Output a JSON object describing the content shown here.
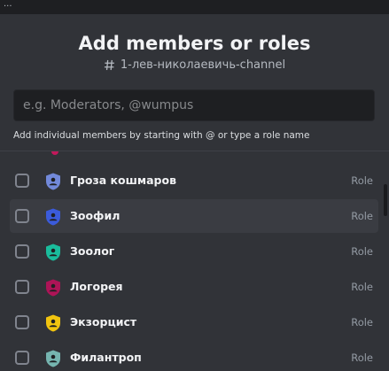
{
  "topbar": {
    "text": "..."
  },
  "modal": {
    "title": "Add members or roles",
    "channel_name": "1-лев-николаевичь-channel",
    "search": {
      "placeholder": "e.g. Moderators, @wumpus",
      "value": ""
    },
    "hint": "Add individual members by starting with @ or type a role name"
  },
  "roles": [
    {
      "name": "Гроза кошмаров",
      "type": "Role",
      "color": "#7289da",
      "checked": false
    },
    {
      "name": "Зоофил",
      "type": "Role",
      "color": "#3b5bdb",
      "checked": false
    },
    {
      "name": "Зоолог",
      "type": "Role",
      "color": "#1abc9c",
      "checked": false
    },
    {
      "name": "Логорея",
      "type": "Role",
      "color": "#ad1457",
      "checked": false
    },
    {
      "name": "Экзорцист",
      "type": "Role",
      "color": "#f1c40f",
      "checked": false
    },
    {
      "name": "Филантроп",
      "type": "Role",
      "color": "#76b5b0",
      "checked": false
    }
  ],
  "icons": {
    "channel": "hash-icon",
    "role": "shield-user-icon"
  },
  "colors": {
    "background": "#313338",
    "hover": "#3a3c42",
    "accent_peek": "#c2185b"
  }
}
